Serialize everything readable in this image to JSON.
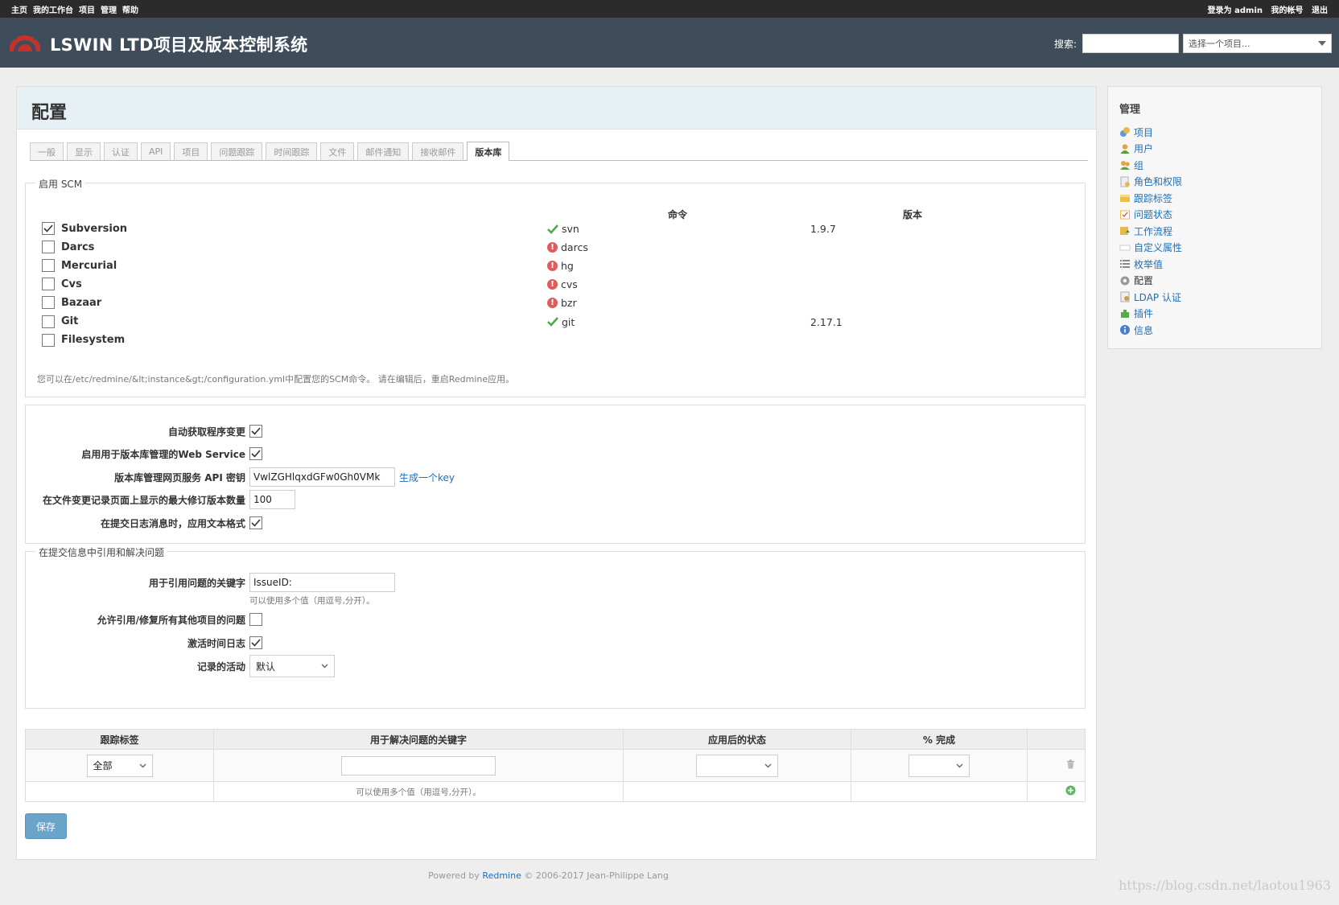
{
  "top_menu": {
    "left": [
      "主页",
      "我的工作台",
      "项目",
      "管理",
      "帮助"
    ],
    "logged_in": "登录为 admin",
    "my_account": "我的帐号",
    "logout": "退出"
  },
  "header": {
    "title": "LSWIN LTD项目及版本控制系统",
    "search_label": "搜索:",
    "search_value": "",
    "project_jump": "选择一个项目..."
  },
  "page": {
    "title": "配置"
  },
  "tabs": [
    "一般",
    "显示",
    "认证",
    "API",
    "项目",
    "问题跟踪",
    "时间跟踪",
    "文件",
    "邮件通知",
    "接收邮件",
    "版本库"
  ],
  "selected_tab": "版本库",
  "scm": {
    "legend": "启用 SCM",
    "col_command": "命令",
    "col_version": "版本",
    "rows": [
      {
        "name": "Subversion",
        "checked": true,
        "status": "ok",
        "command": "svn",
        "version": "1.9.7"
      },
      {
        "name": "Darcs",
        "checked": false,
        "status": "error",
        "command": "darcs",
        "version": ""
      },
      {
        "name": "Mercurial",
        "checked": false,
        "status": "error",
        "command": "hg",
        "version": ""
      },
      {
        "name": "Cvs",
        "checked": false,
        "status": "error",
        "command": "cvs",
        "version": ""
      },
      {
        "name": "Bazaar",
        "checked": false,
        "status": "error",
        "command": "bzr",
        "version": ""
      },
      {
        "name": "Git",
        "checked": false,
        "status": "ok",
        "command": "git",
        "version": "2.17.1"
      },
      {
        "name": "Filesystem",
        "checked": false,
        "status": "",
        "command": "",
        "version": ""
      }
    ],
    "hint": "您可以在/etc/redmine/&lt;instance&gt;/configuration.yml中配置您的SCM命令。 请在编辑后，重启Redmine应用。"
  },
  "settings": {
    "autofetch_label": "自动获取程序变更",
    "autofetch": true,
    "ws_label": "启用用于版本库管理的Web Service",
    "ws": true,
    "api_key_label": "版本库管理网页服务 API 密钥",
    "api_key": "VwlZGHlqxdGFw0Gh0VMk",
    "generate_key": "生成一个key",
    "max_rev_label": "在文件变更记录页面上显示的最大修订版本数量",
    "max_rev": "100",
    "text_format_label": "在提交日志消息时，应用文本格式",
    "text_format": true
  },
  "commit": {
    "legend": "在提交信息中引用和解决问题",
    "ref_keywords_label": "用于引用问题的关键字",
    "ref_keywords": "IssueID:",
    "ref_hint": "可以使用多个值（用逗号,分开）。",
    "cross_project_label": "允许引用/修复所有其他项目的问题",
    "cross_project": false,
    "time_log_label": "激活时间日志",
    "time_log": true,
    "activity_label": "记录的活动",
    "activity": "默认"
  },
  "kw_table": {
    "headers": [
      "跟踪标签",
      "用于解决问题的关键字",
      "应用后的状态",
      "% 完成",
      ""
    ],
    "tracker": "全部",
    "keywords": "",
    "status": "",
    "done_ratio": "",
    "hint": "可以使用多个值（用逗号,分开）。"
  },
  "save_label": "保存",
  "sidebar": {
    "title": "管理",
    "items": [
      {
        "label": "项目",
        "icon": "projects-icon",
        "color": "#5b9bd5"
      },
      {
        "label": "用户",
        "icon": "user-icon",
        "color": "#e8a23a"
      },
      {
        "label": "组",
        "icon": "group-icon",
        "color": "#6a9b45"
      },
      {
        "label": "角色和权限",
        "icon": "roles-icon",
        "color": "#b0b0b0"
      },
      {
        "label": "跟踪标签",
        "icon": "tracker-icon",
        "color": "#e8c04a"
      },
      {
        "label": "问题状态",
        "icon": "issue-status-icon",
        "color": "#e8b84a"
      },
      {
        "label": "工作流程",
        "icon": "workflow-icon",
        "color": "#e8b84a"
      },
      {
        "label": "自定义属性",
        "icon": "custom-fields-icon",
        "color": "#cccccc"
      },
      {
        "label": "枚举值",
        "icon": "list-icon",
        "color": "#888888"
      },
      {
        "label": "配置",
        "icon": "settings-icon",
        "color": "#999999"
      },
      {
        "label": "LDAP 认证",
        "icon": "ldap-icon",
        "color": "#c8a050"
      },
      {
        "label": "插件",
        "icon": "plugin-icon",
        "color": "#5aa84a"
      },
      {
        "label": "信息",
        "icon": "info-icon",
        "color": "#4a7fc8"
      }
    ],
    "current": "配置"
  },
  "footer": {
    "prefix": "Powered by",
    "link": "Redmine",
    "suffix": "© 2006-2017 Jean-Philippe Lang"
  },
  "watermark": "https://blog.csdn.net/laotou1963"
}
